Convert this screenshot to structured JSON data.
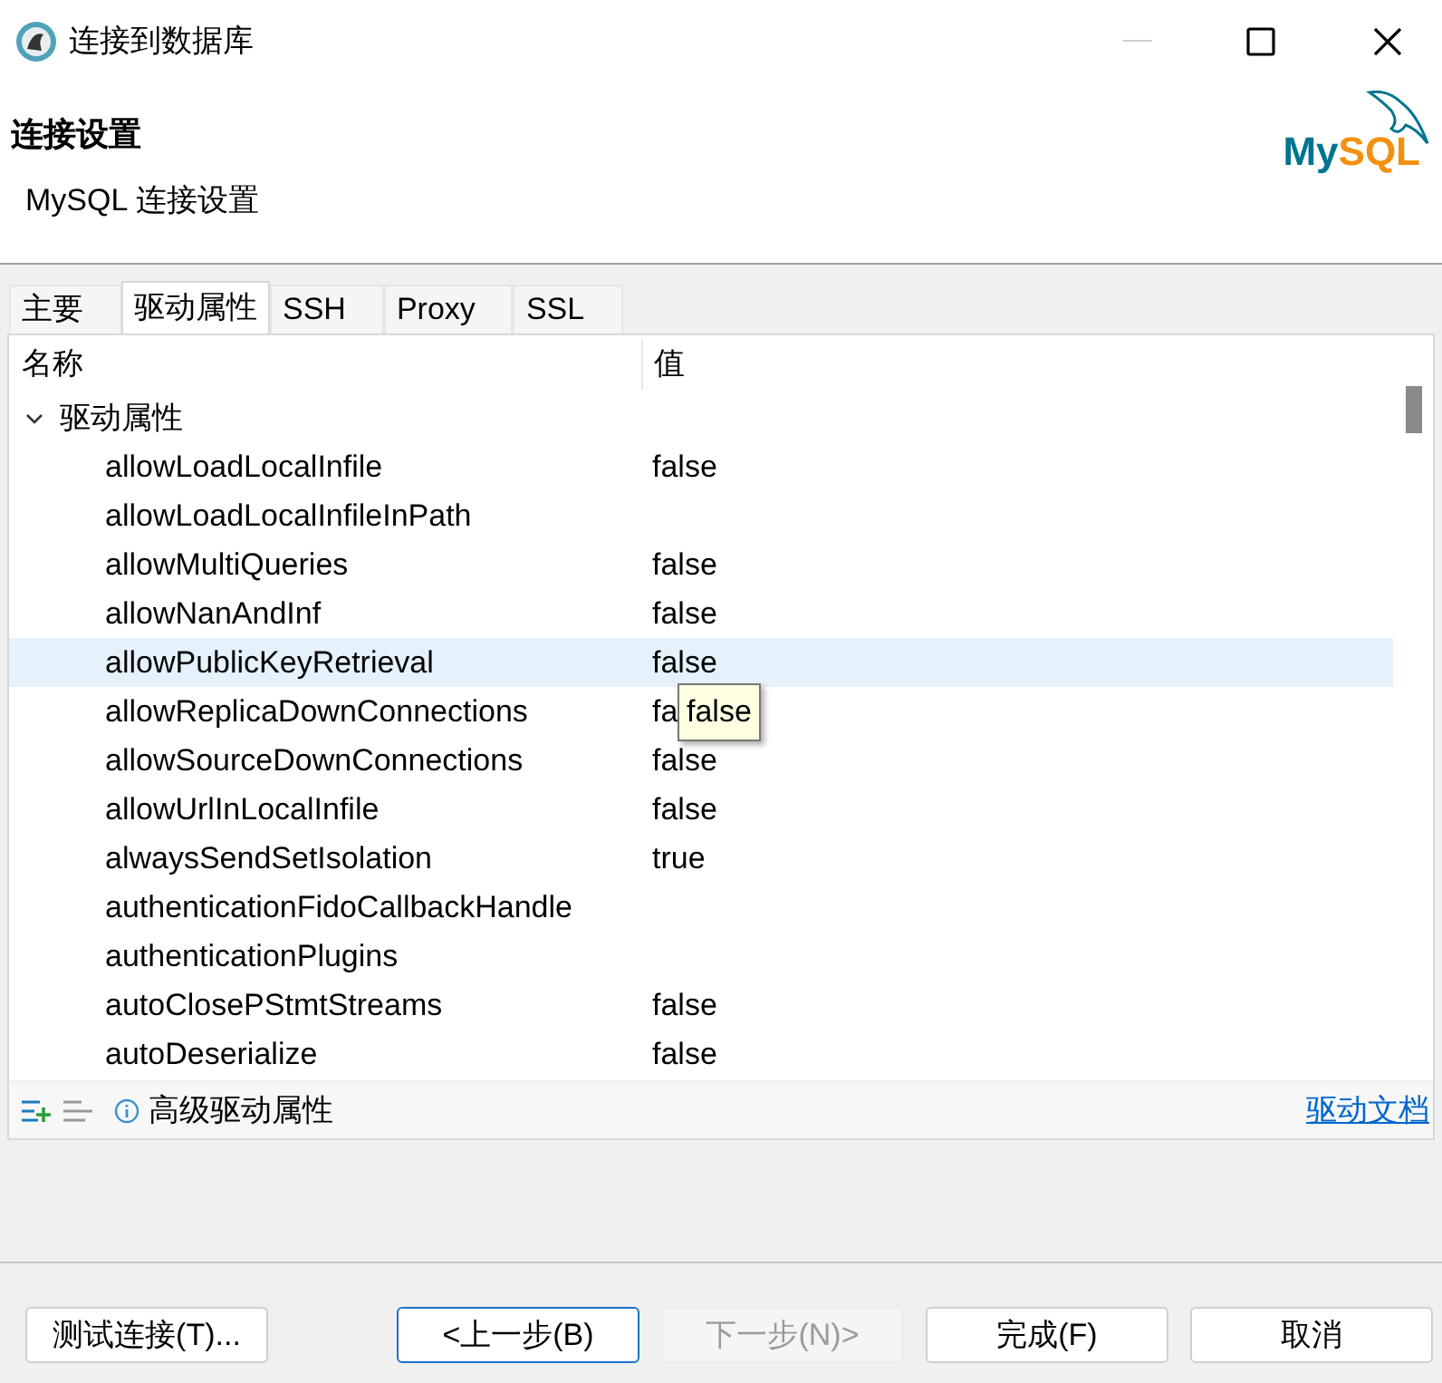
{
  "window": {
    "title": "连接到数据库",
    "minimize_disabled": true
  },
  "header": {
    "title": "连接设置",
    "subtitle": "MySQL 连接设置",
    "logo": [
      "My",
      "SQL"
    ]
  },
  "tabs": [
    {
      "label": "主要",
      "selected": false
    },
    {
      "label": "驱动属性",
      "selected": true
    },
    {
      "label": "SSH",
      "selected": false
    },
    {
      "label": "Proxy",
      "selected": false
    },
    {
      "label": "SSL",
      "selected": false
    }
  ],
  "table": {
    "columns": [
      "名称",
      "值"
    ],
    "groups": [
      {
        "name": "驱动属性",
        "expanded": true,
        "children": [
          {
            "name": "allowLoadLocalInfile",
            "value": "false",
            "selected": false
          },
          {
            "name": "allowLoadLocalInfileInPath",
            "selected": false
          },
          {
            "name": "allowMultiQueries",
            "value": "false",
            "selected": false
          },
          {
            "name": "allowNanAndInf",
            "value": "false",
            "selected": false
          },
          {
            "name": "allowPublicKeyRetrieval",
            "value": "false",
            "selected": true
          },
          {
            "name": "allowReplicaDownConnections",
            "value": "fa",
            "selected": false
          },
          {
            "name": "allowSourceDownConnections",
            "value": "false",
            "selected": false
          },
          {
            "name": "allowUrlInLocalInfile",
            "value": "false",
            "selected": false
          },
          {
            "name": "alwaysSendSetIsolation",
            "value": "true",
            "selected": false
          },
          {
            "name": "authenticationFidoCallbackHandle",
            "selected": false
          },
          {
            "name": "authenticationPlugins",
            "selected": false
          },
          {
            "name": "autoClosePStmtStreams",
            "value": "false",
            "selected": false
          },
          {
            "name": "autoDeserialize",
            "value": "false",
            "selected": false
          }
        ]
      }
    ]
  },
  "tooltip": "false",
  "toolbar": {
    "label": "高级驱动属性",
    "link": "驱动文档"
  },
  "buttons": [
    {
      "label": "测试连接(T)...",
      "disabled": false,
      "focused": false
    },
    {
      "label": "<上一步(B)",
      "disabled": false,
      "focused": true
    },
    {
      "label": "下一步(N)>",
      "disabled": true,
      "focused": false
    },
    {
      "label": "完成(F)",
      "disabled": false,
      "focused": false
    },
    {
      "label": "取消",
      "disabled": false,
      "focused": false
    }
  ]
}
